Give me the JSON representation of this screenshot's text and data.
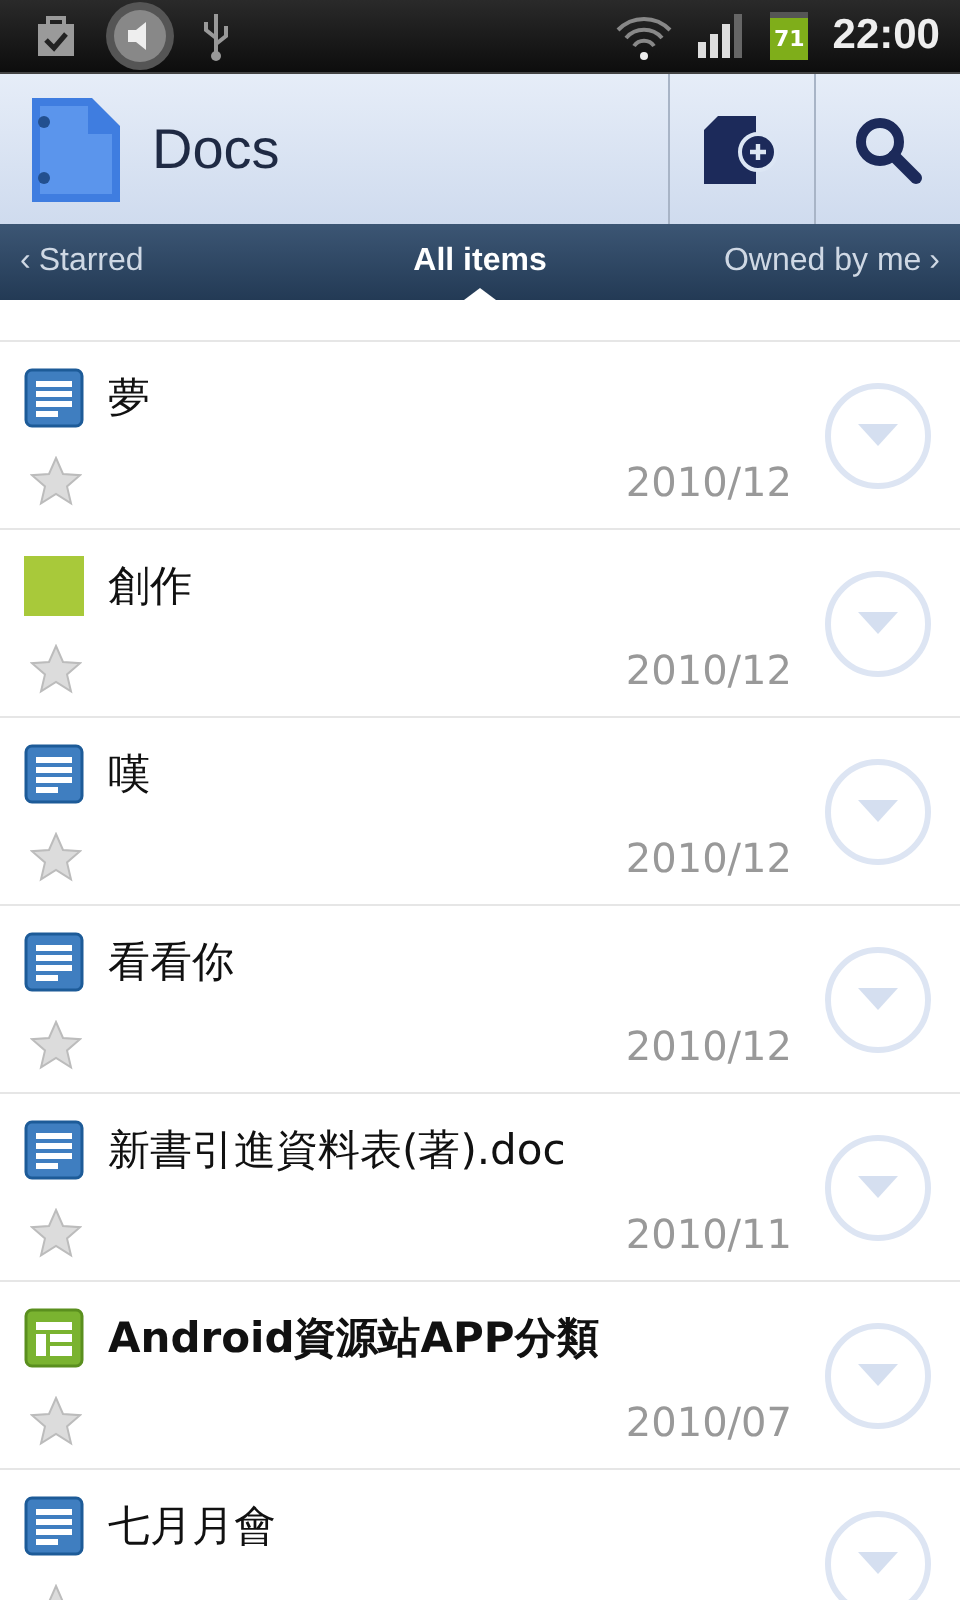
{
  "status_bar": {
    "battery": "71",
    "time": "22:00"
  },
  "app_bar": {
    "title": "Docs"
  },
  "tabs": [
    {
      "prefix": "‹",
      "label": "Starred",
      "selected": false
    },
    {
      "label": "All items",
      "selected": true
    },
    {
      "label": "Owned by me",
      "suffix": "›",
      "selected": false
    }
  ],
  "items": [
    {
      "kind": "document",
      "title": "夢",
      "date": "2010/12",
      "starred": false
    },
    {
      "kind": "collection",
      "title": "創作",
      "date": "2010/12",
      "starred": false
    },
    {
      "kind": "document",
      "title": "嘆",
      "date": "2010/12",
      "starred": false
    },
    {
      "kind": "document",
      "title": "看看你",
      "date": "2010/12",
      "starred": false
    },
    {
      "kind": "document",
      "title": "新書引進資料表(著).doc",
      "date": "2010/11",
      "starred": false
    },
    {
      "kind": "spreadsheet",
      "title": "Android資源站APP分類",
      "date": "2010/07",
      "starred": false
    },
    {
      "kind": "document",
      "title": "七月月會",
      "starred": false
    }
  ]
}
